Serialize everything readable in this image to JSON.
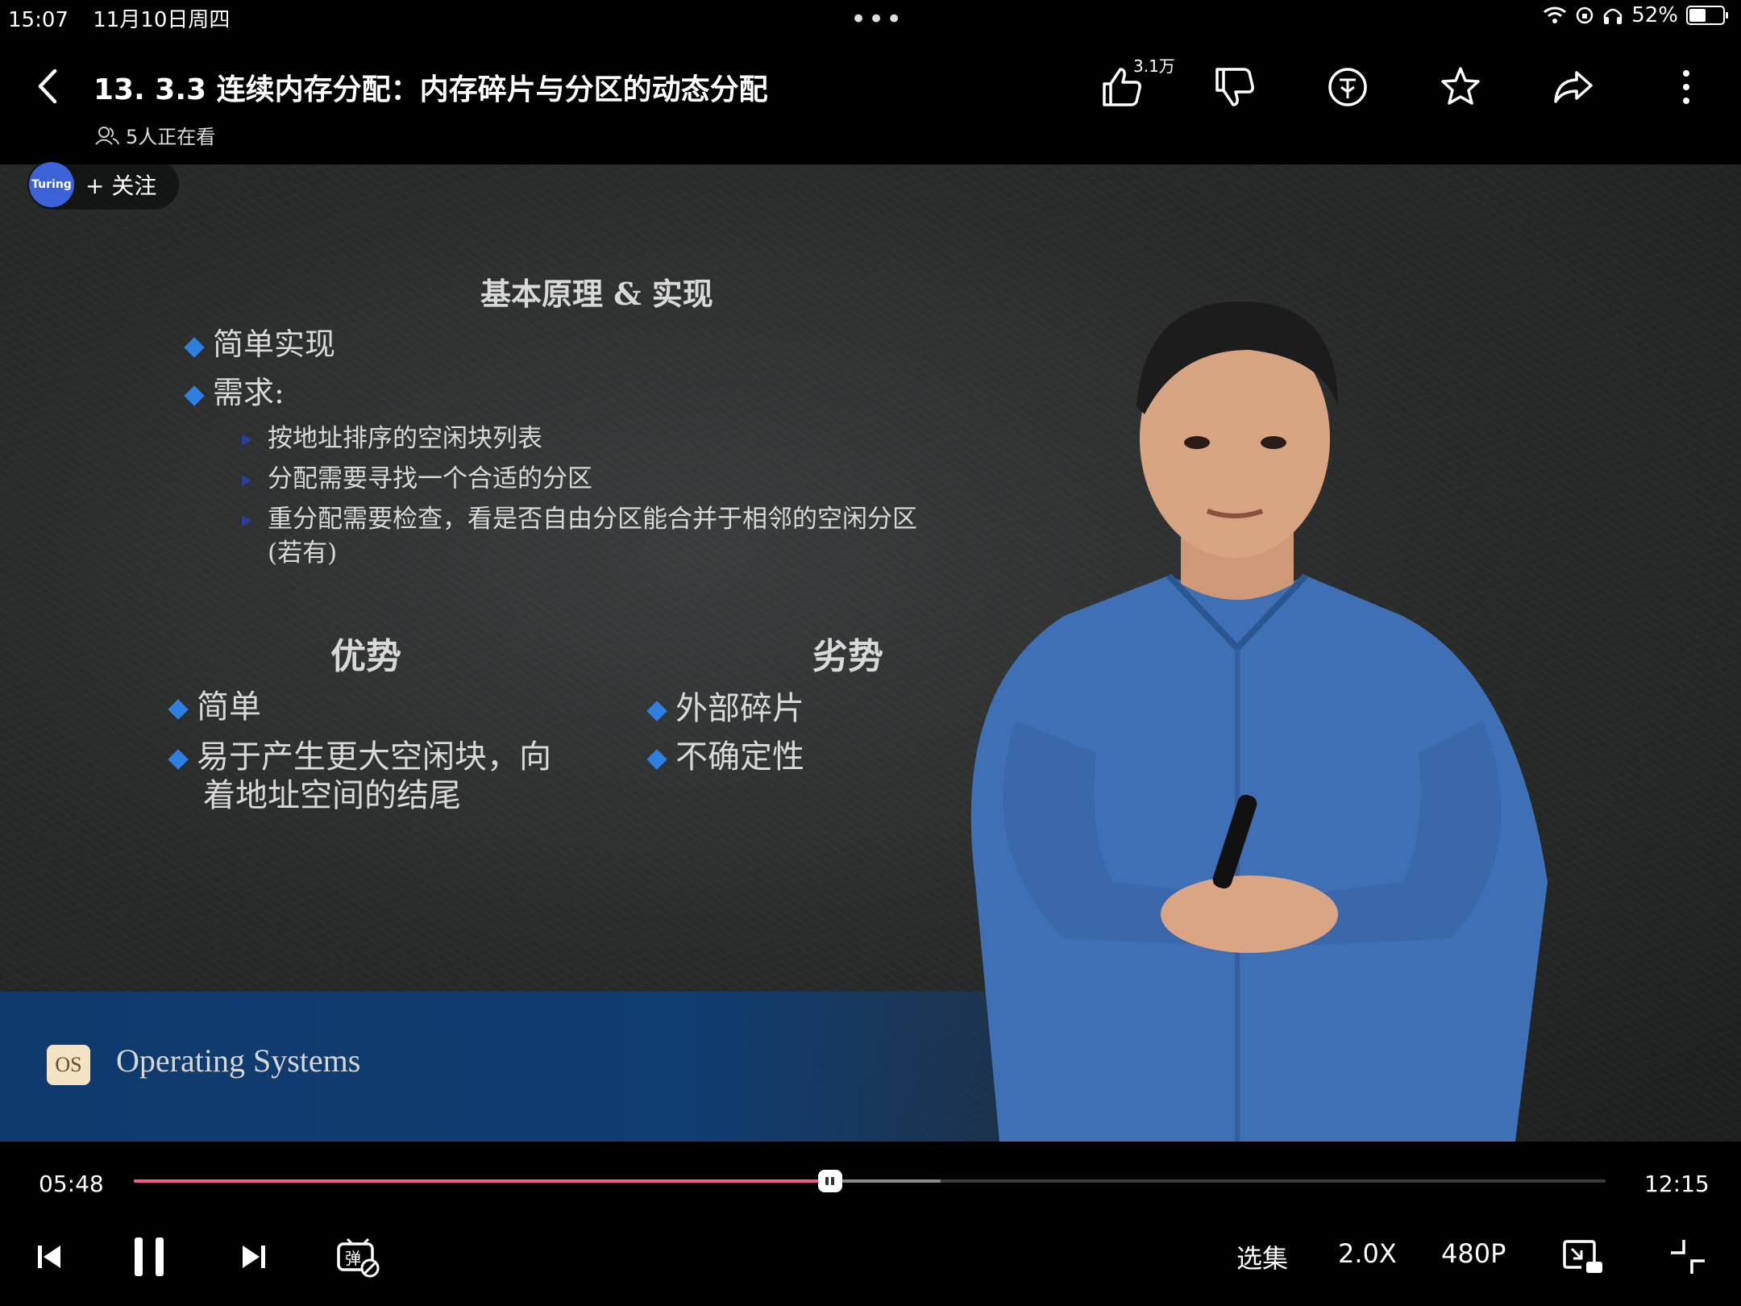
{
  "status_bar": {
    "time": "15:07",
    "date": "11月10日周四",
    "battery": "52%",
    "battery_level": 0.52,
    "icons": [
      "wifi-icon",
      "orientation-lock-icon",
      "headphones-icon",
      "battery-icon"
    ]
  },
  "header": {
    "title": "13. 3.3 连续内存分配：内存碎片与分区的动态分配",
    "watching": "5人正在看",
    "like_count": "3.1万",
    "actions": [
      "like-icon",
      "dislike-icon",
      "coin-icon",
      "favorite-icon",
      "share-icon",
      "more-icon"
    ]
  },
  "uploader": {
    "avatar_text": "Turing",
    "follow_label": "+ 关注"
  },
  "slide": {
    "heading": "基本原理 & 实现",
    "bullets": [
      "简单实现",
      "需求:"
    ],
    "sub_bullets": [
      "按地址排序的空闲块列表",
      "分配需要寻找一个合适的分区",
      "重分配需要检查，看是否自由分区能合并于相邻的空闲分区"
    ],
    "sub_bullet_tail": "(若有)",
    "pros_title": "优势",
    "pros": [
      "简单",
      "易于产生更大空闲块，向",
      "着地址空间的结尾"
    ],
    "cons_title": "劣势",
    "cons": [
      "外部碎片",
      "不确定性"
    ],
    "course_logo": "OS",
    "course_name": "Operating Systems"
  },
  "player": {
    "current_time": "05:48",
    "duration": "12:15",
    "played_fraction": 0.473,
    "buffered_fraction": 0.548,
    "episodes_label": "选集",
    "speed_label": "2.0X",
    "quality_label": "480P",
    "controls": [
      "previous-icon",
      "pause-icon",
      "next-icon",
      "danmaku-toggle-icon",
      "picture-in-picture-icon",
      "exit-fullscreen-icon"
    ]
  },
  "colors": {
    "progress": "#f25d8e",
    "bullet": "#2f7fe0",
    "band": "#0f3a6e"
  }
}
